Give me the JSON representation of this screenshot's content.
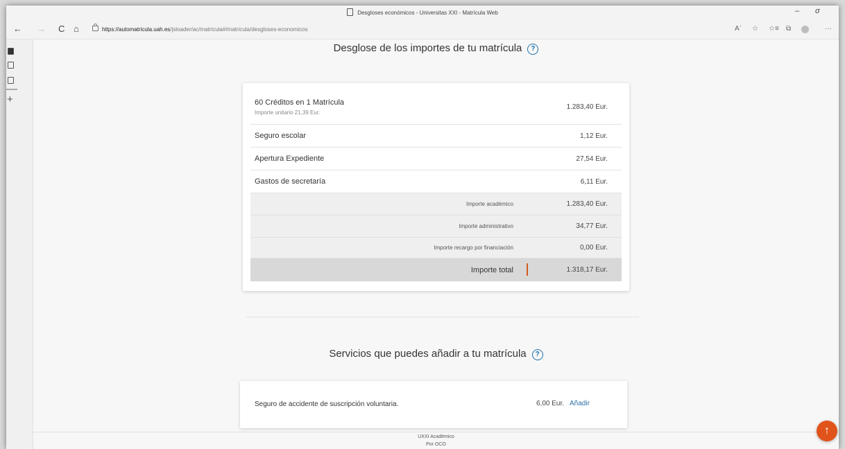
{
  "window": {
    "title": "Desgloses económicos - Universitas XXI - Matrícula Web",
    "url_host": "https://automatricula.uah.es",
    "url_path": "/jsloader/ac/matricula#/matricula/desgloses-economicos"
  },
  "icons": {
    "minimize": "–",
    "restore": "σ",
    "back": "←",
    "forward": "→",
    "reload": "C",
    "home": "⌂",
    "read_aloud": "Aʾ",
    "favorite_add": "☆",
    "favorites": "☆≡",
    "collections": "⧉",
    "more": "···",
    "help": "?",
    "scroll_top": "↑",
    "plus": "+"
  },
  "breakdown": {
    "title": "Desglose de los importes de tu matrícula",
    "items": [
      {
        "label": "60 Créditos en 1 Matrícula",
        "sub": "Importe unitario 21,39 Eur.",
        "amount": "1.283,40 Eur."
      },
      {
        "label": "Seguro escolar",
        "amount": "1,12 Eur."
      },
      {
        "label": "Apertura Expediente",
        "amount": "27,54 Eur."
      },
      {
        "label": "Gastos de secretaría",
        "amount": "6,11 Eur."
      }
    ],
    "subtotals": [
      {
        "label": "Importe académico",
        "amount": "1.283,40 Eur."
      },
      {
        "label": "Importe administrativo",
        "amount": "34,77 Eur."
      },
      {
        "label": "Importe recargo por financiación",
        "amount": "0,00 Eur."
      }
    ],
    "total": {
      "label": "Importe total",
      "amount": "1.318,17 Eur."
    }
  },
  "services": {
    "title": "Servicios que puedes añadir a tu matrícula",
    "item": {
      "label": "Seguro de accidente de suscripción voluntaria.",
      "amount": "6,00 Eur.",
      "action": "Añadir"
    }
  },
  "footer": {
    "line1": "UXXI Académico",
    "line2": "Por OCO"
  },
  "colors": {
    "accent": "#e0541b",
    "link": "#2a6ea6",
    "help": "#1b6fa8"
  }
}
